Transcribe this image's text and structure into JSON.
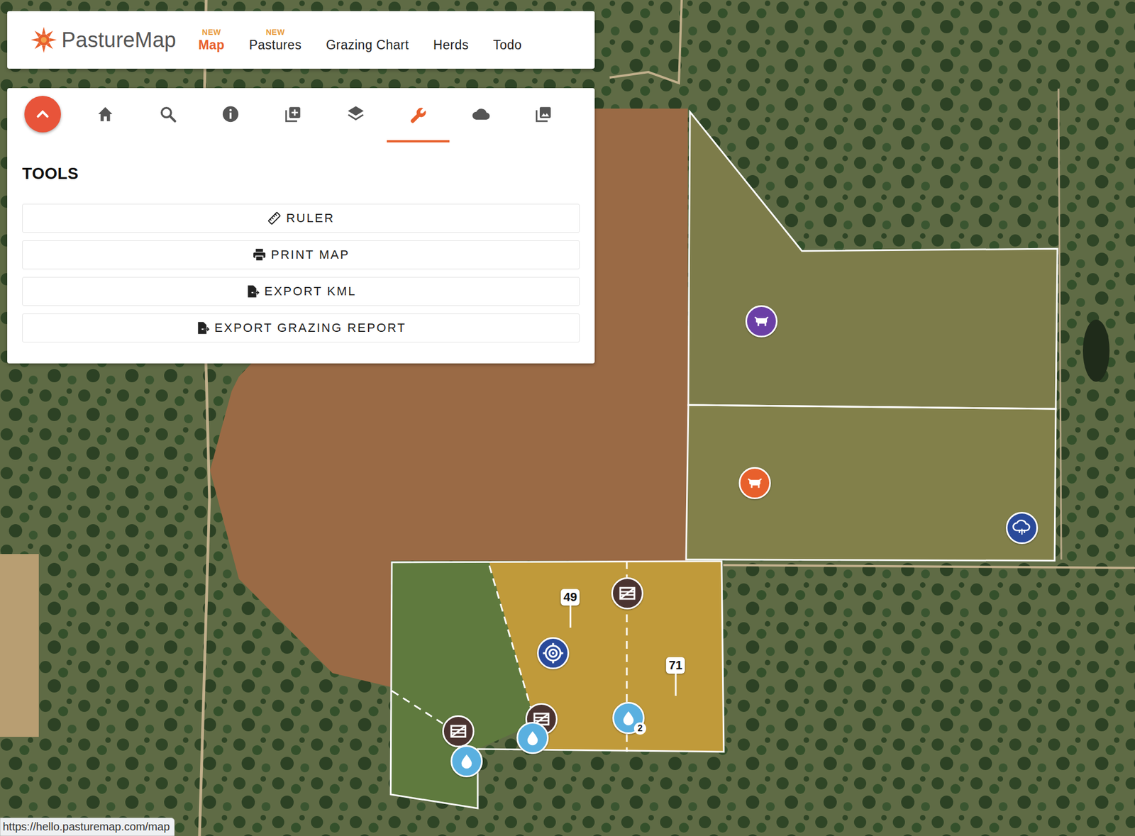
{
  "nav": {
    "logo": "PastureMap",
    "items": [
      {
        "label": "Map",
        "badge": "NEW",
        "selected": true
      },
      {
        "label": "Pastures",
        "badge": "NEW",
        "selected": false
      },
      {
        "label": "Grazing Chart",
        "badge": "",
        "selected": false
      },
      {
        "label": "Herds",
        "badge": "",
        "selected": false
      },
      {
        "label": "Todo",
        "badge": "",
        "selected": false
      }
    ]
  },
  "toolbar": {
    "tabs": [
      {
        "selected": false
      },
      {
        "selected": false
      },
      {
        "selected": false
      },
      {
        "selected": false
      },
      {
        "selected": false
      },
      {
        "selected": false
      },
      {
        "selected": true
      },
      {
        "selected": false
      },
      {
        "selected": false
      }
    ]
  },
  "tools": {
    "title": "TOOLS",
    "buttons": [
      "RULER",
      "PRINT MAP",
      "EXPORT KML",
      "EXPORT GRAZING REPORT"
    ]
  },
  "map": {
    "labels": [
      {
        "text": "49"
      },
      {
        "text": "71"
      }
    ],
    "markers": [
      {
        "kind": "herd",
        "color": "#6b3fa6"
      },
      {
        "kind": "herd",
        "color": "#e8602c"
      },
      {
        "kind": "rain"
      },
      {
        "kind": "target"
      },
      {
        "kind": "gate"
      },
      {
        "kind": "gate"
      },
      {
        "kind": "gate"
      },
      {
        "kind": "water"
      },
      {
        "kind": "water"
      },
      {
        "kind": "water",
        "count": "2"
      }
    ]
  },
  "status_bar": {
    "url": "https://hello.pasturemap.com/map"
  }
}
